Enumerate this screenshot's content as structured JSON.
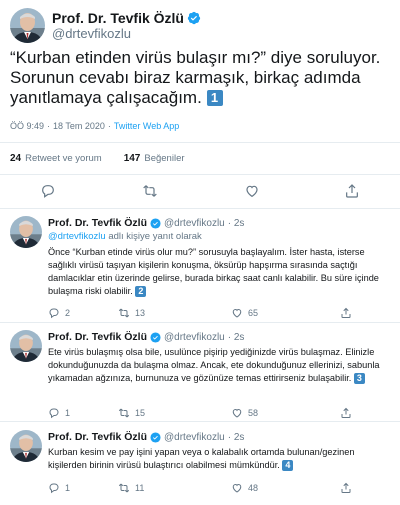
{
  "main_tweet": {
    "author_name": "Prof. Dr. Tevfik Özlü",
    "handle": "@drtevfikozlu",
    "text_prefix": "“Kurban etinden virüs bulaşır mı?” diye soruluyor. Sorunun cevabı biraz karmaşık, birkaç adımda yanıtlamaya çalışacağım.",
    "badge": "1",
    "time": "ÖÖ 9:49",
    "dot": "·",
    "date": "18 Tem 2020",
    "source": "Twitter Web App",
    "retweets_count": "24",
    "retweets_label": "Retweet ve yorum",
    "likes_count": "147",
    "likes_label": "Beğeniler"
  },
  "replies": [
    {
      "author_name": "Prof. Dr. Tevfik Özlü",
      "handle": "@drtevfikozlu",
      "time": "· 2s",
      "reply_to_handle": "@drtevfikozlu",
      "reply_to_suffix": "adlı kişiye yanıt olarak",
      "text": "Önce “Kurban etinde virüs olur mu?” sorusuyla başlayalım. İster hasta, isterse sağlıklı virüsü taşıyan kişilerin konuşma, öksürüp hapşırma sırasında saçtığı damlacıklar etin üzerinde gelirse, burada birkaç saat canlı kalabilir. Bu süre içinde bulaşma riski olabilir.",
      "badge": "2",
      "reply_count": "2",
      "retweet_count": "13",
      "like_count": "65"
    },
    {
      "author_name": "Prof. Dr. Tevfik Özlü",
      "handle": "@drtevfikozlu",
      "time": "· 2s",
      "text": "Ete virüs bulaşmış olsa bile, usulünce pişirip yediğinizde virüs bulaşmaz. Elinizle dokunduğunuzda da bulaşma olmaz. Ancak, ete dokunduğunuz ellerinizi, sabunla yıkamadan ağzınıza, burnunuza ve gözünüze temas ettirirseniz bulaşabilir.",
      "badge": "3",
      "reply_count": "1",
      "retweet_count": "15",
      "like_count": "58"
    },
    {
      "author_name": "Prof. Dr. Tevfik Özlü",
      "handle": "@drtevfikozlu",
      "time": "· 2s",
      "text": "Kurban kesim ve pay işini yapan veya o kalabalık ortamda bulunan/gezinen kişilerden birinin virüsü bulaştırıcı olabilmesi mümkündür.",
      "badge": "4",
      "reply_count": "1",
      "retweet_count": "11",
      "like_count": "48"
    }
  ],
  "colors": {
    "accent": "#1da1f2",
    "text": "#14171a",
    "muted": "#657786",
    "badge": "#3b88c3",
    "divider": "#e6ecf0"
  },
  "icons": [
    "verified-icon",
    "reply-icon",
    "retweet-icon",
    "like-icon",
    "share-icon"
  ]
}
